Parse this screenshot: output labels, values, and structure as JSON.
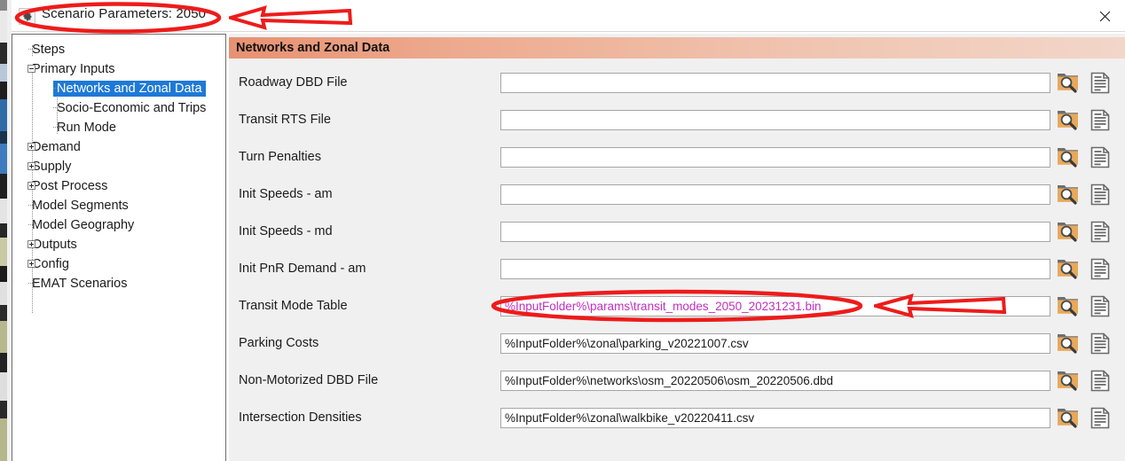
{
  "window": {
    "title": "Scenario Parameters: 2050",
    "app_icon": "gear-icon",
    "close_label": "✕"
  },
  "sidebar": {
    "items": [
      {
        "label": "Steps",
        "level": 1,
        "type": "leaf",
        "selected": false
      },
      {
        "label": "Primary Inputs",
        "level": 1,
        "type": "collapse",
        "selected": false
      },
      {
        "label": "Networks and Zonal Data",
        "level": 2,
        "type": "leaf",
        "selected": true
      },
      {
        "label": "Socio-Economic and Trips",
        "level": 2,
        "type": "leaf",
        "selected": false
      },
      {
        "label": "Run Mode",
        "level": 2,
        "type": "leaf",
        "selected": false
      },
      {
        "label": "Demand",
        "level": 1,
        "type": "expand",
        "selected": false
      },
      {
        "label": "Supply",
        "level": 1,
        "type": "expand",
        "selected": false
      },
      {
        "label": "Post Process",
        "level": 1,
        "type": "expand",
        "selected": false
      },
      {
        "label": "Model Segments",
        "level": 1,
        "type": "leaf",
        "selected": false
      },
      {
        "label": "Model Geography",
        "level": 1,
        "type": "leaf",
        "selected": false
      },
      {
        "label": "Outputs",
        "level": 1,
        "type": "expand",
        "selected": false
      },
      {
        "label": "Config",
        "level": 1,
        "type": "expand",
        "selected": false
      },
      {
        "label": "EMAT Scenarios",
        "level": 1,
        "type": "leaf",
        "selected": false
      }
    ]
  },
  "panel": {
    "header": "Networks and Zonal Data",
    "fields": [
      {
        "label": "Roadway DBD File",
        "value": "",
        "highlight": false,
        "browse_icon": "folder-search-icon",
        "doc_icon": "document-icon"
      },
      {
        "label": "Transit RTS File",
        "value": "",
        "highlight": false,
        "browse_icon": "folder-search-icon",
        "doc_icon": "document-icon"
      },
      {
        "label": "Turn Penalties",
        "value": "",
        "highlight": false,
        "browse_icon": "folder-search-icon",
        "doc_icon": "document-icon"
      },
      {
        "label": "Init Speeds - am",
        "value": "",
        "highlight": false,
        "browse_icon": "folder-search-icon",
        "doc_icon": "document-icon"
      },
      {
        "label": "Init Speeds - md",
        "value": "",
        "highlight": false,
        "browse_icon": "folder-search-icon",
        "doc_icon": "document-icon"
      },
      {
        "label": "Init PnR Demand - am",
        "value": "",
        "highlight": false,
        "browse_icon": "folder-search-icon",
        "doc_icon": "document-icon"
      },
      {
        "label": "Transit Mode Table",
        "value": "%InputFolder%\\params\\transit_modes_2050_20231231.bin",
        "highlight": true,
        "browse_icon": "folder-search-icon",
        "doc_icon": "document-icon"
      },
      {
        "label": "Parking Costs",
        "value": "%InputFolder%\\zonal\\parking_v20221007.csv",
        "highlight": false,
        "browse_icon": "folder-search-icon",
        "doc_icon": "document-icon"
      },
      {
        "label": "Non-Motorized DBD File",
        "value": "%InputFolder%\\networks\\osm_20220506\\osm_20220506.dbd",
        "highlight": false,
        "browse_icon": "folder-search-icon",
        "doc_icon": "document-icon"
      },
      {
        "label": "Intersection Densities",
        "value": "%InputFolder%\\zonal\\walkbike_v20220411.csv",
        "highlight": false,
        "browse_icon": "folder-search-icon",
        "doc_icon": "document-icon"
      }
    ]
  },
  "annotations": {
    "color": "#EE1B1B",
    "items": [
      {
        "name": "title-ellipse",
        "shape": "ellipse",
        "target": "Scenario Parameters: 2050"
      },
      {
        "name": "title-arrow",
        "shape": "arrow-left",
        "target": "Scenario Parameters: 2050"
      },
      {
        "name": "transit-mode-ellipse",
        "shape": "ellipse",
        "target": "Transit Mode Table value"
      },
      {
        "name": "transit-mode-arrow",
        "shape": "arrow-left",
        "target": "Transit Mode Table value"
      }
    ]
  },
  "colors": {
    "selection": "#1E79D6",
    "header_gradient_start": "#E79171",
    "header_gradient_end": "#F2D6C9",
    "highlight_text": "#C02FC0",
    "annotation_red": "#EE1B1B",
    "folder_icon": "#E8A95C"
  }
}
